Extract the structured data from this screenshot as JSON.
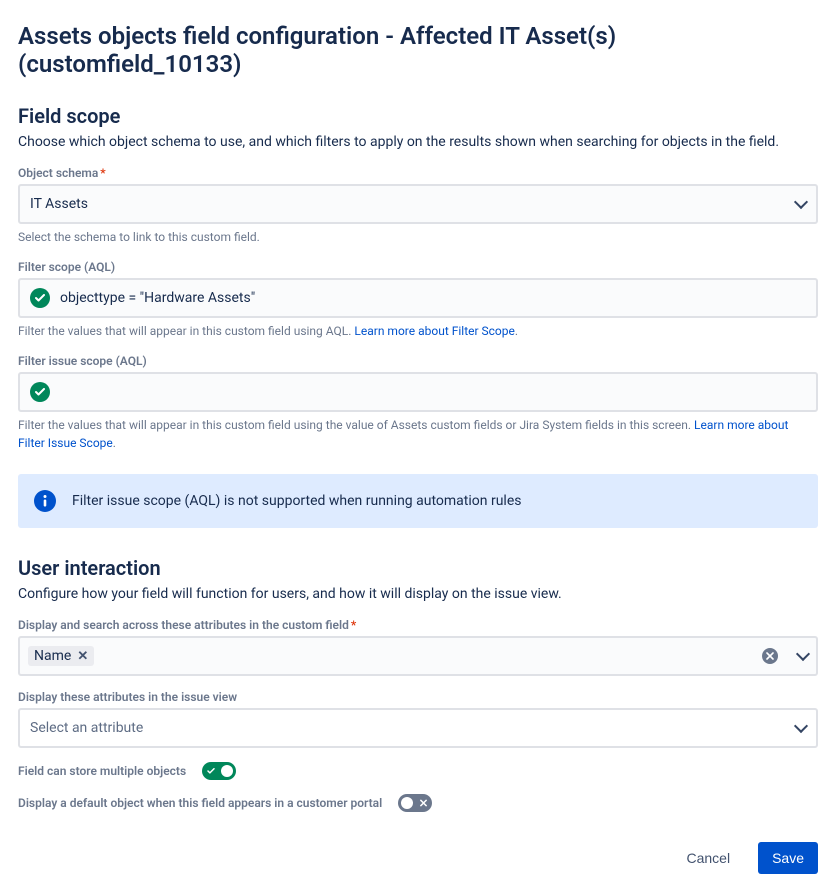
{
  "page": {
    "title": "Assets objects field configuration - Affected IT Asset(s) (customfield_10133)"
  },
  "fieldScope": {
    "heading": "Field scope",
    "description": "Choose which object schema to use, and which filters to apply on the results shown when searching for objects in the field.",
    "objectSchema": {
      "label": "Object schema",
      "value": "IT Assets",
      "helper": "Select the schema to link to this custom field."
    },
    "filterScope": {
      "label": "Filter scope (AQL)",
      "value": "objecttype = \"Hardware Assets\"",
      "helperPrefix": "Filter the values that will appear in this custom field using AQL. ",
      "helperLink": "Learn more about Filter Scope",
      "helperSuffix": "."
    },
    "filterIssueScope": {
      "label": "Filter issue scope (AQL)",
      "value": "",
      "helperPrefix": "Filter the values that will appear in this custom field using the value of Assets custom fields or Jira System fields in this screen. ",
      "helperLink": "Learn more about Filter Issue Scope",
      "helperSuffix": "."
    },
    "infoBanner": "Filter issue scope (AQL) is not supported when running automation rules"
  },
  "userInteraction": {
    "heading": "User interaction",
    "description": "Configure how your field will function for users, and how it will display on the issue view.",
    "displaySearchAttributes": {
      "label": "Display and search across these attributes in the custom field",
      "tags": [
        "Name"
      ]
    },
    "displayIssueViewAttributes": {
      "label": "Display these attributes in the issue view",
      "placeholder": "Select an attribute"
    },
    "multipleObjects": {
      "label": "Field can store multiple objects",
      "value": true
    },
    "defaultObjectPortal": {
      "label": "Display a default object when this field appears in a customer portal",
      "value": false
    }
  },
  "footer": {
    "cancel": "Cancel",
    "save": "Save"
  }
}
